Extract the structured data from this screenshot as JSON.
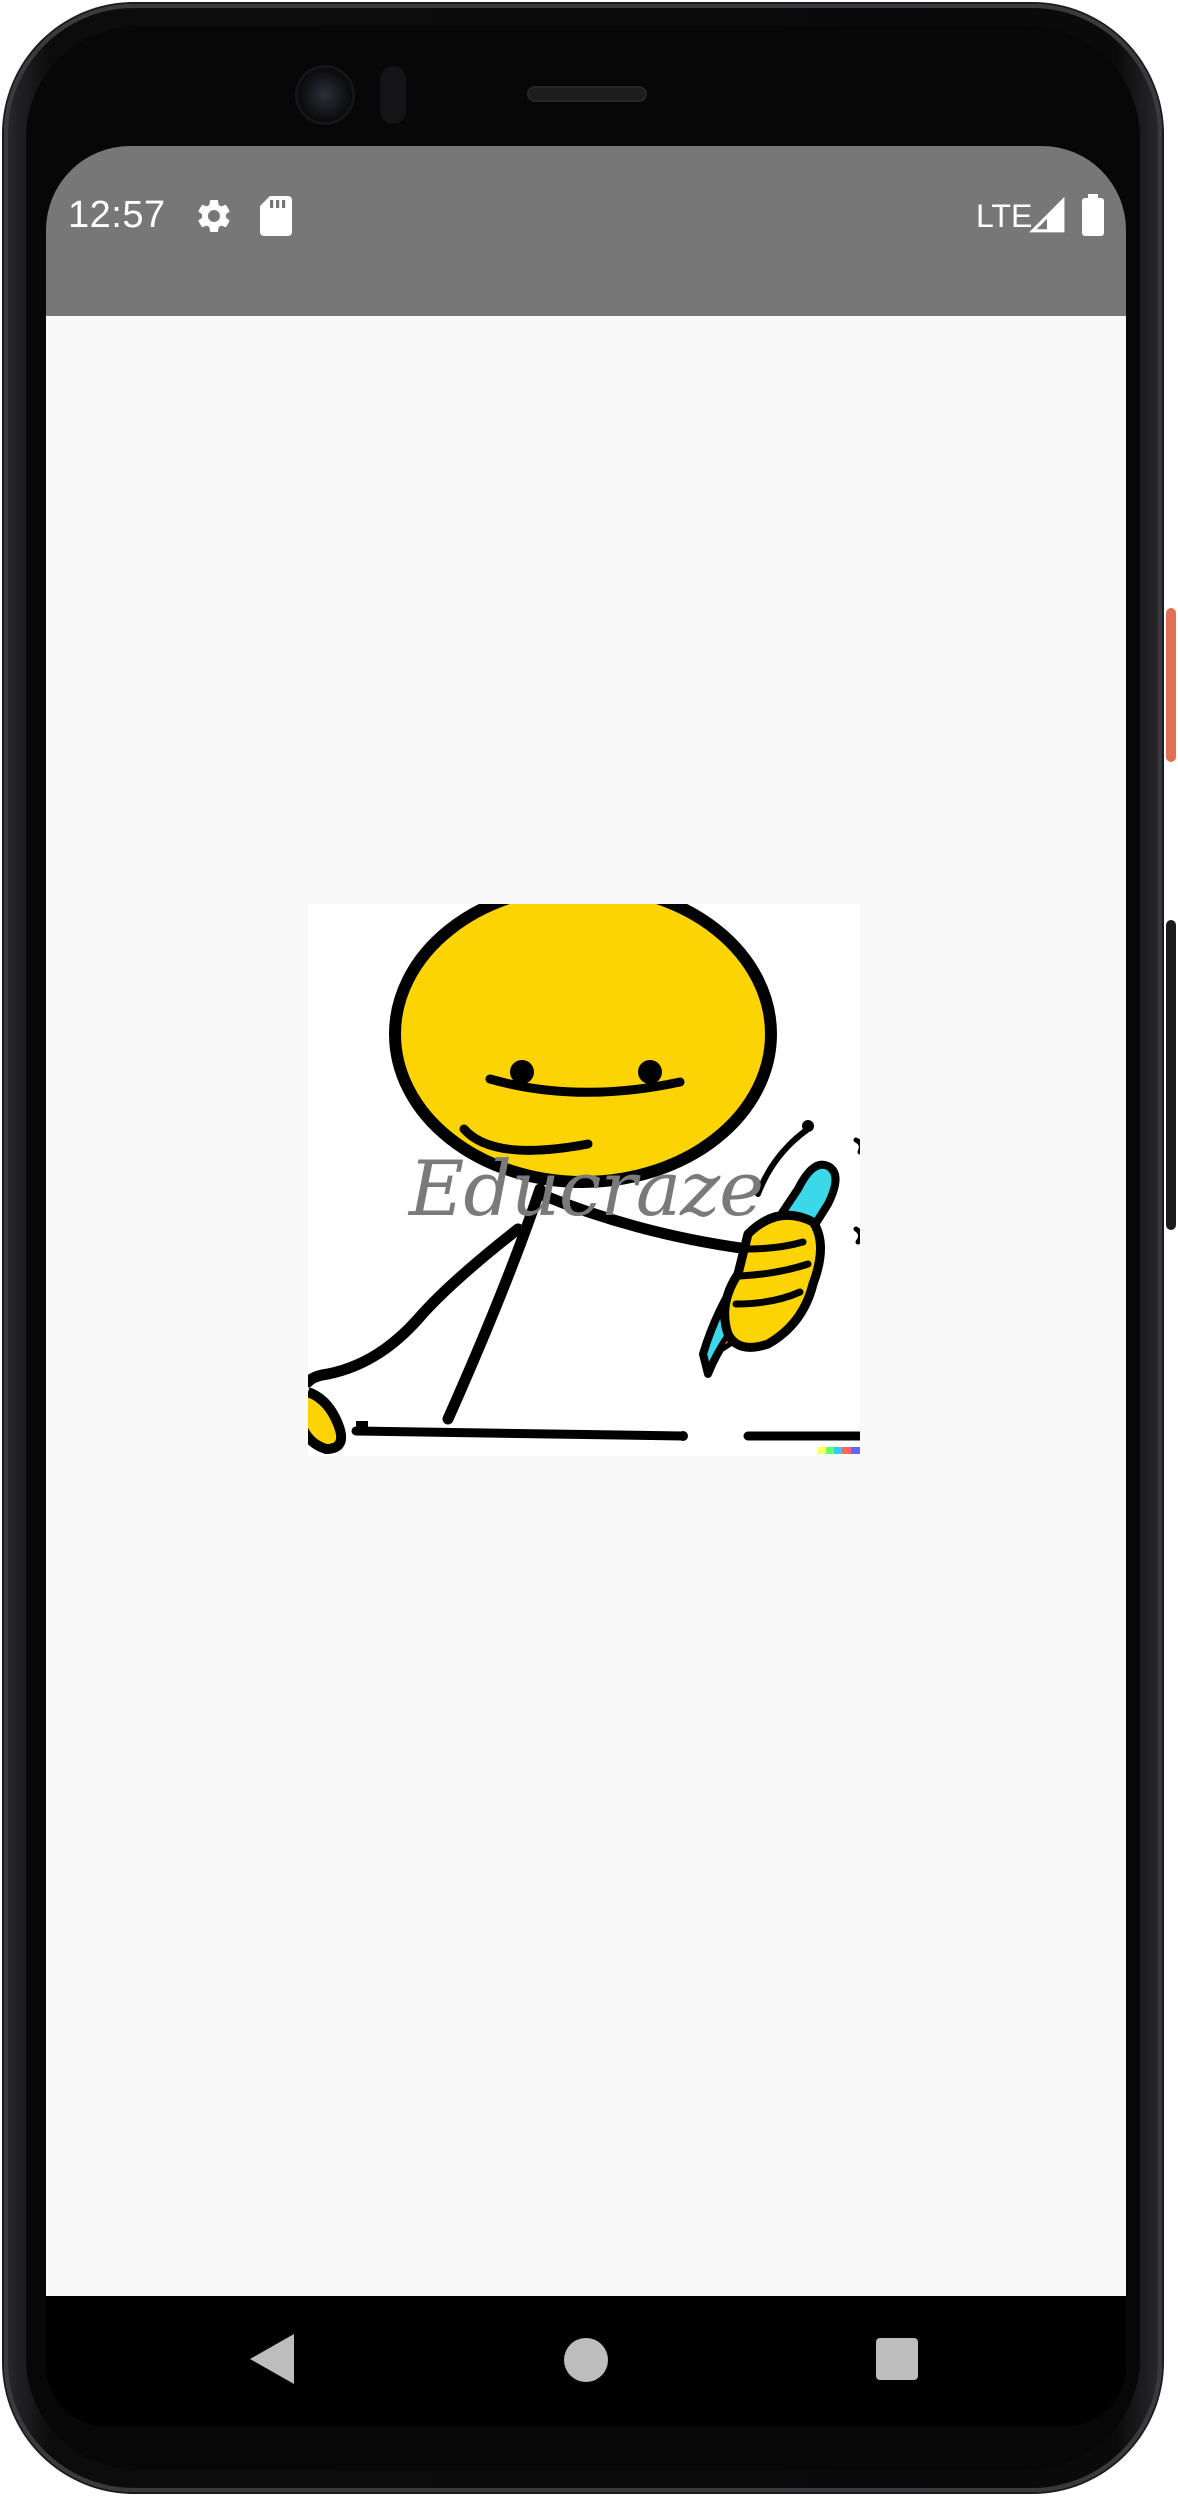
{
  "status_bar": {
    "time": "12:57",
    "network_label": "LTE",
    "icons": [
      "gear-icon",
      "sd-card-icon",
      "signal-icon",
      "battery-icon"
    ],
    "background_color": "#777777"
  },
  "splash": {
    "app_name": "Educraze",
    "illustration": "stick-figure-writing-with-pen",
    "text_color": "#7a7a7a",
    "background_color": "#f9f9f9"
  },
  "nav_bar": {
    "buttons": [
      "back-icon",
      "home-icon",
      "recents-icon"
    ]
  }
}
